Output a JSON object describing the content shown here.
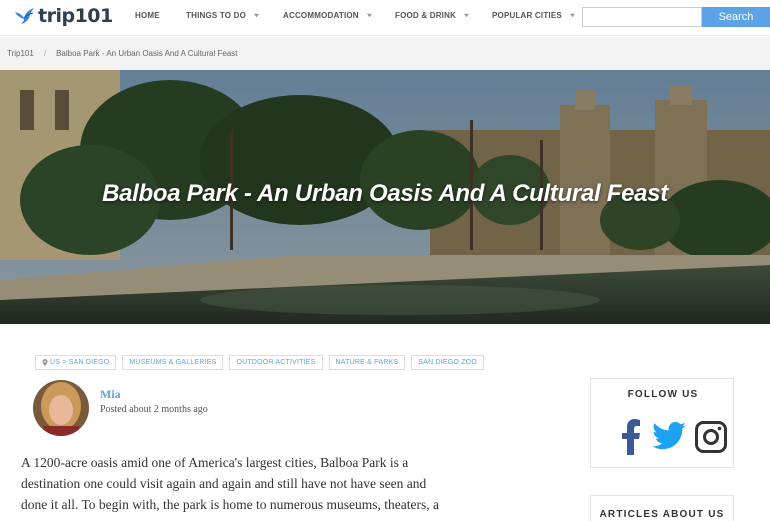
{
  "header": {
    "logo_text": "trip101",
    "nav": [
      {
        "label": "HOME",
        "has_dropdown": false
      },
      {
        "label": "THINGS TO DO",
        "has_dropdown": true
      },
      {
        "label": "ACCOMMODATION",
        "has_dropdown": true
      },
      {
        "label": "FOOD & DRINK",
        "has_dropdown": true
      },
      {
        "label": "POPULAR CITIES",
        "has_dropdown": true
      }
    ],
    "search": {
      "value": "",
      "button_label": "Search"
    }
  },
  "breadcrumb": {
    "items": [
      "Trip101",
      "Balboa Park - An Urban Oasis And A Cultural Feast"
    ],
    "separator": "/"
  },
  "hero": {
    "title": "Balboa Park - An Urban Oasis And A Cultural Feast"
  },
  "tags": [
    {
      "label": "US > SAN DIEGO",
      "icon": "location-pin-icon"
    },
    {
      "label": "MUSEUMS & GALLERIES"
    },
    {
      "label": "OUTDOOR ACTIVITIES"
    },
    {
      "label": "NATURE & PARKS"
    },
    {
      "label": "SAN DIEGO ZOO"
    }
  ],
  "author": {
    "name": "Mia",
    "posted": "Posted about 2 months ago"
  },
  "article": {
    "lines": [
      "A 1200-acre oasis amid one of America's largest cities, Balboa Park is a",
      "destination one could visit again and again and still have not have seen and",
      "done it all. To begin with, the park is home to numerous museums, theaters, a"
    ]
  },
  "sidebar": {
    "follow_title": "FOLLOW US",
    "social": [
      "facebook-icon",
      "twitter-icon",
      "instagram-icon"
    ],
    "about_title": "ARTICLES ABOUT US"
  },
  "colors": {
    "accent": "#5ba3e6",
    "facebook": "#3b5998",
    "twitter": "#1da1f2",
    "instagram": "#333333"
  }
}
